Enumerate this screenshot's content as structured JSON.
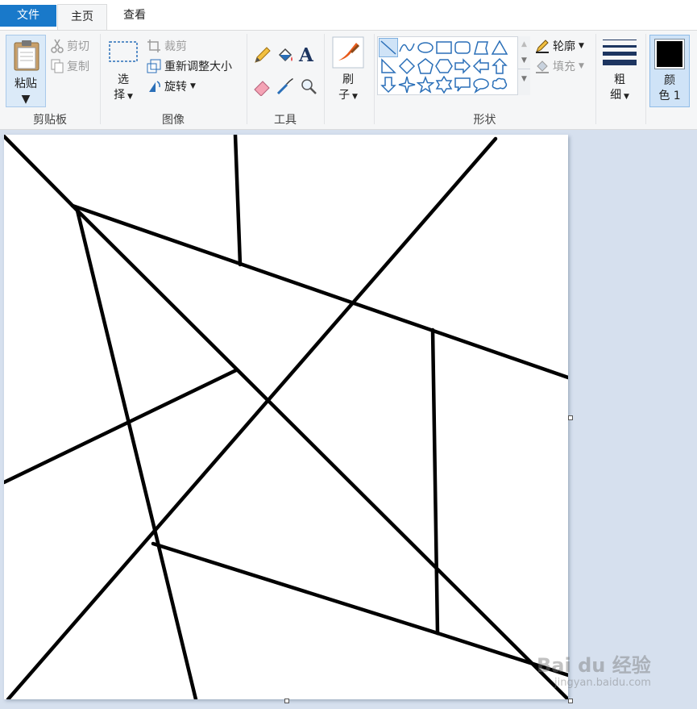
{
  "tabs": {
    "file": "文件",
    "home": "主页",
    "view": "查看"
  },
  "clipboard": {
    "paste": "粘贴",
    "cut": "剪切",
    "copy": "复制",
    "group": "剪贴板"
  },
  "image": {
    "select_line1": "选",
    "select_line2": "择",
    "crop": "裁剪",
    "resize": "重新调整大小",
    "rotate": "旋转",
    "group": "图像"
  },
  "tools": {
    "group": "工具",
    "text_glyph": "A"
  },
  "brushes": {
    "line1": "刷",
    "line2": "子"
  },
  "shapes": {
    "outline": "轮廓",
    "fill": "填充",
    "group": "形状"
  },
  "size": {
    "line1": "粗",
    "line2": "细"
  },
  "color": {
    "line1": "颜",
    "line2": "色 1",
    "value": "#000000"
  },
  "watermark": {
    "brand": "Bai du 经验",
    "url": "jingyan.baidu.com"
  }
}
